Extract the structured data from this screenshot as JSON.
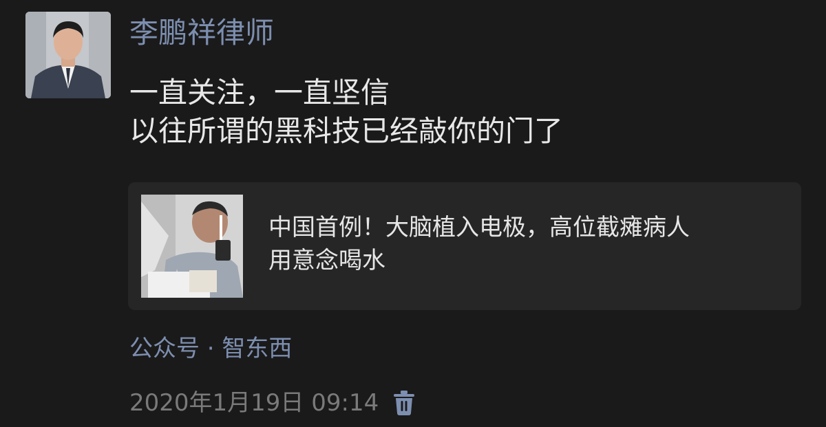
{
  "post": {
    "author": "李鹏祥律师",
    "text_lines": [
      "一直关注，一直坚信",
      "以往所谓的黑科技已经敲你的门了"
    ],
    "link": {
      "title_lines": [
        "中国首例！大脑植入电极，高位截瘫病人",
        "用意念喝水"
      ]
    },
    "source": "公众号 · 智东西",
    "timestamp": "2020年1月19日 09:14",
    "delete_icon": "trash-icon"
  },
  "colors": {
    "background": "#1a1a1a",
    "name_link": "#7d8fb0",
    "body_text": "#e8e8e8",
    "card_bg": "#262626",
    "timestamp": "#7a7a7a",
    "delete_icon": "#7d8fb0"
  }
}
